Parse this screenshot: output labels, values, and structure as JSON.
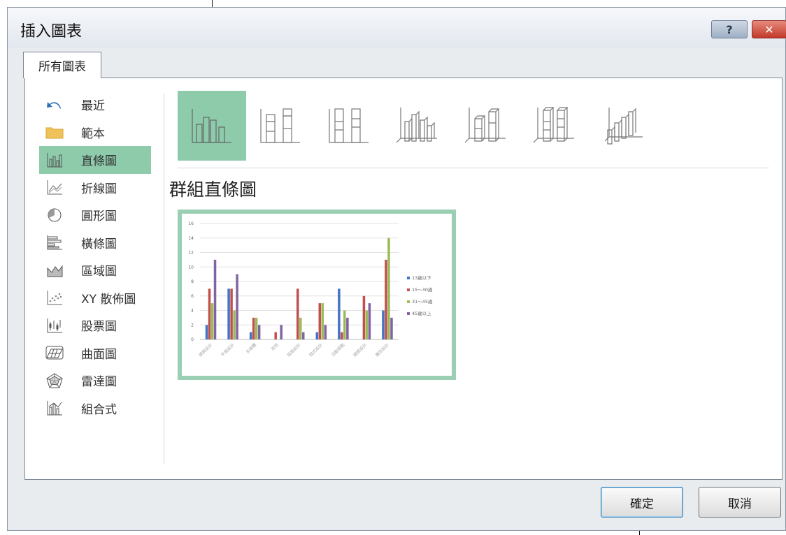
{
  "window": {
    "title": "插入圖表",
    "help_glyph": "?",
    "close_glyph": "✕"
  },
  "tabs": [
    {
      "label": "所有圖表"
    }
  ],
  "sidebar": {
    "selected_index": 2,
    "items": [
      {
        "label": "最近",
        "icon": "recent-undo-icon"
      },
      {
        "label": "範本",
        "icon": "template-folder-icon"
      },
      {
        "label": "直條圖",
        "icon": "column-chart-icon"
      },
      {
        "label": "折線圖",
        "icon": "line-chart-icon"
      },
      {
        "label": "圓形圖",
        "icon": "pie-chart-icon"
      },
      {
        "label": "橫條圖",
        "icon": "bar-chart-icon"
      },
      {
        "label": "區域圖",
        "icon": "area-chart-icon"
      },
      {
        "label": "XY 散佈圖",
        "icon": "scatter-chart-icon"
      },
      {
        "label": "股票圖",
        "icon": "stock-chart-icon"
      },
      {
        "label": "曲面圖",
        "icon": "surface-chart-icon"
      },
      {
        "label": "雷達圖",
        "icon": "radar-chart-icon"
      },
      {
        "label": "組合式",
        "icon": "combo-chart-icon"
      }
    ]
  },
  "subtypes": {
    "selected_index": 0,
    "title": "群組直條圖",
    "items": [
      {
        "icon": "clustered-column-icon"
      },
      {
        "icon": "stacked-column-icon"
      },
      {
        "icon": "100-stacked-column-icon"
      },
      {
        "icon": "3d-clustered-column-icon"
      },
      {
        "icon": "3d-stacked-column-icon"
      },
      {
        "icon": "3d-100-stacked-column-icon"
      },
      {
        "icon": "3d-column-icon"
      }
    ]
  },
  "chart_data": {
    "type": "bar",
    "ylim": [
      0,
      16
    ],
    "yticks": [
      0,
      2,
      4,
      6,
      8,
      10,
      12,
      14,
      16
    ],
    "grid": true,
    "legend_position": "right",
    "categories": [
      "網頁設計",
      "平面設計",
      "多媒體",
      "其他",
      "版面設計",
      "程式設計",
      "活動規劃",
      "網路設計",
      "廣告設計"
    ],
    "series": [
      {
        "name": "13歲以下",
        "color": "#4472c4",
        "values": [
          2,
          7,
          1,
          0,
          0,
          1,
          7,
          0,
          4
        ]
      },
      {
        "name": "15～30歲",
        "color": "#c0504d",
        "values": [
          7,
          7,
          3,
          1,
          7,
          5,
          1,
          6,
          11
        ]
      },
      {
        "name": "31～45歲",
        "color": "#9bbb59",
        "values": [
          5,
          4,
          3,
          0,
          3,
          5,
          4,
          4,
          14
        ]
      },
      {
        "name": "45歲以上",
        "color": "#8064a2",
        "values": [
          11,
          9,
          2,
          2,
          1,
          2,
          3,
          5,
          3
        ]
      }
    ]
  },
  "footer": {
    "ok_label": "確定",
    "cancel_label": "取消"
  }
}
